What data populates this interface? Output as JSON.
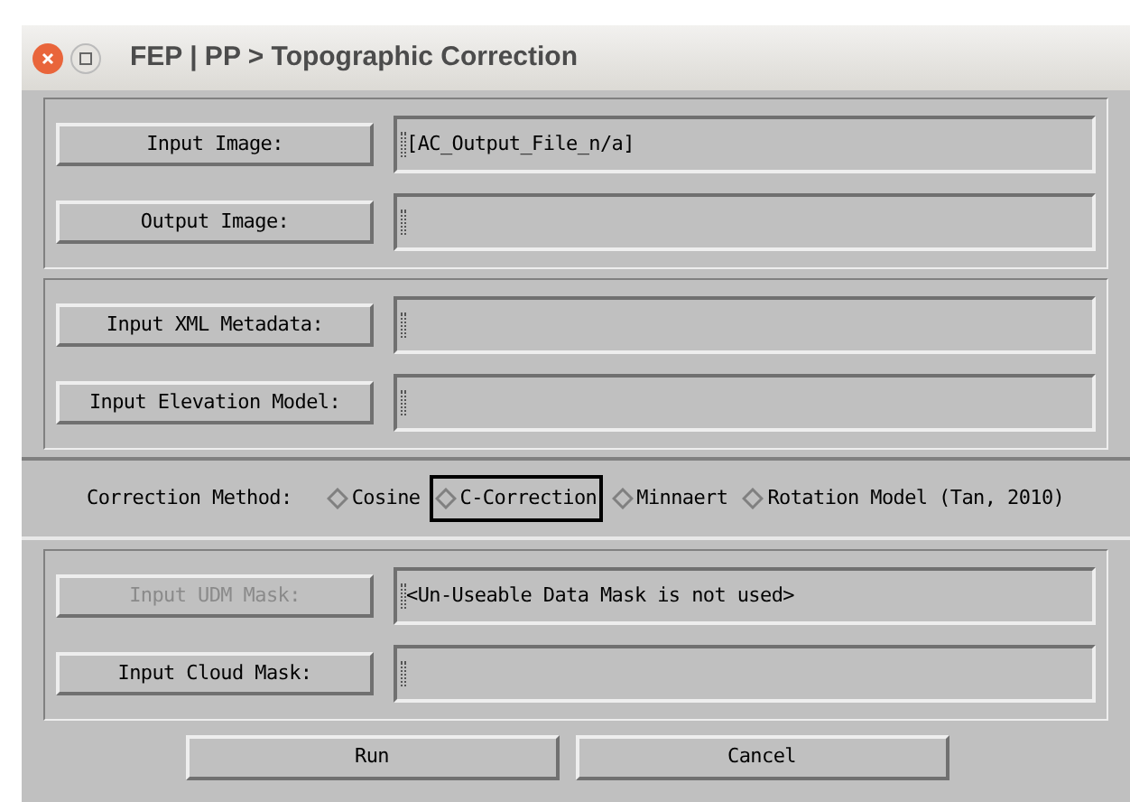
{
  "window": {
    "title": "FEP | PP > Topographic Correction"
  },
  "groups": [
    {
      "rows": [
        {
          "button": "Input Image:",
          "disabled": false,
          "value": "[AC_Output_File_n/a]"
        },
        {
          "button": "Output Image:",
          "disabled": false,
          "value": ""
        }
      ]
    },
    {
      "rows": [
        {
          "button": "Input XML Metadata:",
          "disabled": false,
          "value": ""
        },
        {
          "button": "Input Elevation Model:",
          "disabled": false,
          "value": ""
        }
      ]
    },
    {
      "kind": "radio",
      "label": "Correction Method:",
      "options": [
        {
          "label": "Cosine",
          "selected": false
        },
        {
          "label": "C-Correction",
          "selected": true
        },
        {
          "label": "Minnaert",
          "selected": false
        },
        {
          "label": "Rotation Model (Tan, 2010)",
          "selected": false
        }
      ]
    },
    {
      "rows": [
        {
          "button": "Input UDM Mask:",
          "disabled": true,
          "value": "<Un-Useable Data Mask is not used>"
        },
        {
          "button": "Input Cloud Mask:",
          "disabled": false,
          "value": ""
        }
      ]
    }
  ],
  "buttons": [
    "Run",
    "Cancel"
  ]
}
